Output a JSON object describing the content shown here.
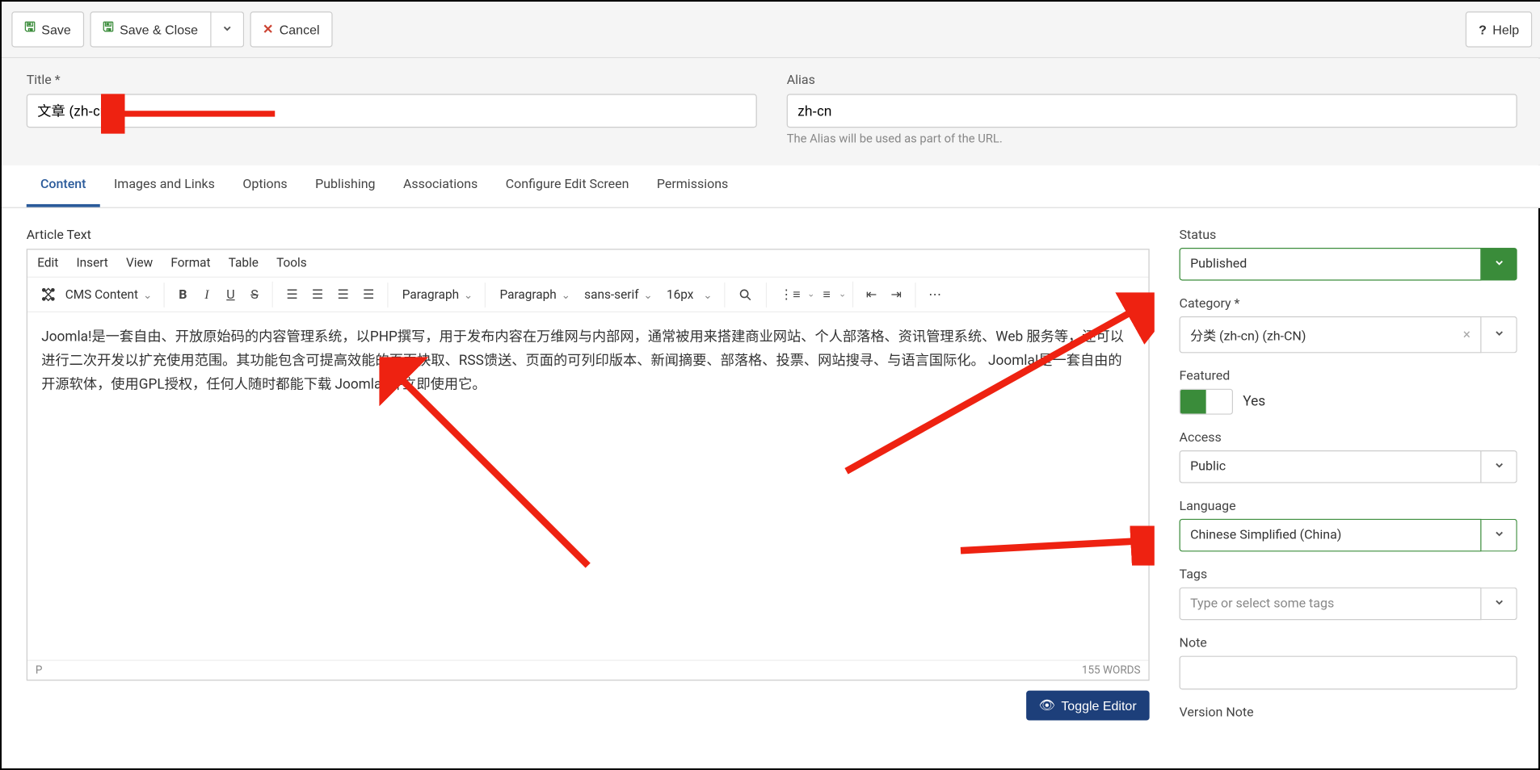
{
  "toolbar": {
    "save": "Save",
    "save_close": "Save & Close",
    "cancel": "Cancel",
    "help": "Help"
  },
  "title_field": {
    "label": "Title *",
    "value": "文章 (zh-cn)"
  },
  "alias_field": {
    "label": "Alias",
    "value": "zh-cn",
    "helper": "The Alias will be used as part of the URL."
  },
  "tabs": [
    "Content",
    "Images and Links",
    "Options",
    "Publishing",
    "Associations",
    "Configure Edit Screen",
    "Permissions"
  ],
  "editor": {
    "label": "Article Text",
    "menubar": [
      "Edit",
      "Insert",
      "View",
      "Format",
      "Table",
      "Tools"
    ],
    "cms_label": "CMS Content",
    "para1": "Paragraph",
    "para2": "Paragraph",
    "font": "sans-serif",
    "size": "16px",
    "body": "Joomla!是一套自由、开放原始码的内容管理系统，以PHP撰写，用于发布内容在万维网与内部网，通常被用来搭建商业网站、个人部落格、资讯管理系统、Web 服务等，还可以进行二次开发以扩充使用范围。其功能包含可提高效能的页面快取、RSS馈送、页面的可列印版本、新闻摘要、部落格、投票、网站搜寻、与语言国际化。 Joomla!是一套自由的开源软体，使用GPL授权，任何人随时都能下载 Joomla! 并立即使用它。",
    "footer_path": "P",
    "footer_words": "155 WORDS",
    "toggle_btn": "Toggle Editor"
  },
  "sidebar": {
    "status_label": "Status",
    "status_value": "Published",
    "category_label": "Category *",
    "category_value": "分类 (zh-cn) (zh-CN)",
    "featured_label": "Featured",
    "featured_text": "Yes",
    "access_label": "Access",
    "access_value": "Public",
    "language_label": "Language",
    "language_value": "Chinese Simplified (China)",
    "tags_label": "Tags",
    "tags_placeholder": "Type or select some tags",
    "note_label": "Note",
    "version_label": "Version Note"
  }
}
